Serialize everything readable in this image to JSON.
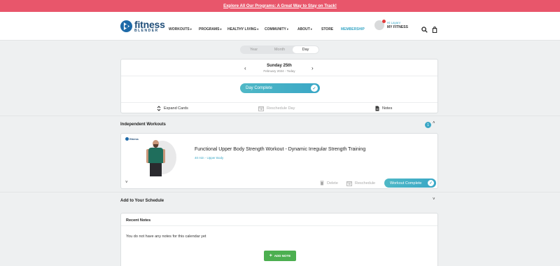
{
  "promo": {
    "text": "Explore All Our Programs: A Great Way to Stay on Track!"
  },
  "brand": {
    "name_top": "fitness",
    "name_bottom": "BLENDER"
  },
  "nav": {
    "workouts": "WORKOUTS",
    "programs": "PROGRAMS",
    "healthy_living": "HEALTHY LIVING",
    "community": "COMMUNITY",
    "about": "ABOUT",
    "store": "STORE",
    "membership": "MEMBERSHIP"
  },
  "account": {
    "greeting": "Hi Layan!",
    "label": "MY FITNESS"
  },
  "view_toggle": {
    "year": "Year",
    "month": "Month",
    "day": "Day",
    "selected": "Day"
  },
  "day": {
    "title": "Sunday 25th",
    "subtitle": "February 2024 - Today",
    "complete_label": "Day Complete",
    "expand_cards": "Expand Cards",
    "reschedule_day": "Reschedule Day",
    "notes": "Notes"
  },
  "independent": {
    "heading": "Independent Workouts",
    "count": "1",
    "workout": {
      "thumb_brand": "fitness",
      "title": "Functional Upper Body Strength Workout - Dynamic Irregular Strength Training",
      "meta": "40 min - Upper Body",
      "delete": "Delete",
      "reschedule": "Reschedule",
      "complete_label": "Workout Complete"
    }
  },
  "add_schedule": {
    "heading": "Add to Your Schedule"
  },
  "recent_notes": {
    "heading": "Recent Notes",
    "empty": "You do not have any notes for this calendar yet",
    "add_button": "ADD NOTE"
  },
  "colors": {
    "accent": "#3aa7c6",
    "promo": "#e8566b",
    "add_note": "#4caf50",
    "brand": "#1f4d78"
  }
}
